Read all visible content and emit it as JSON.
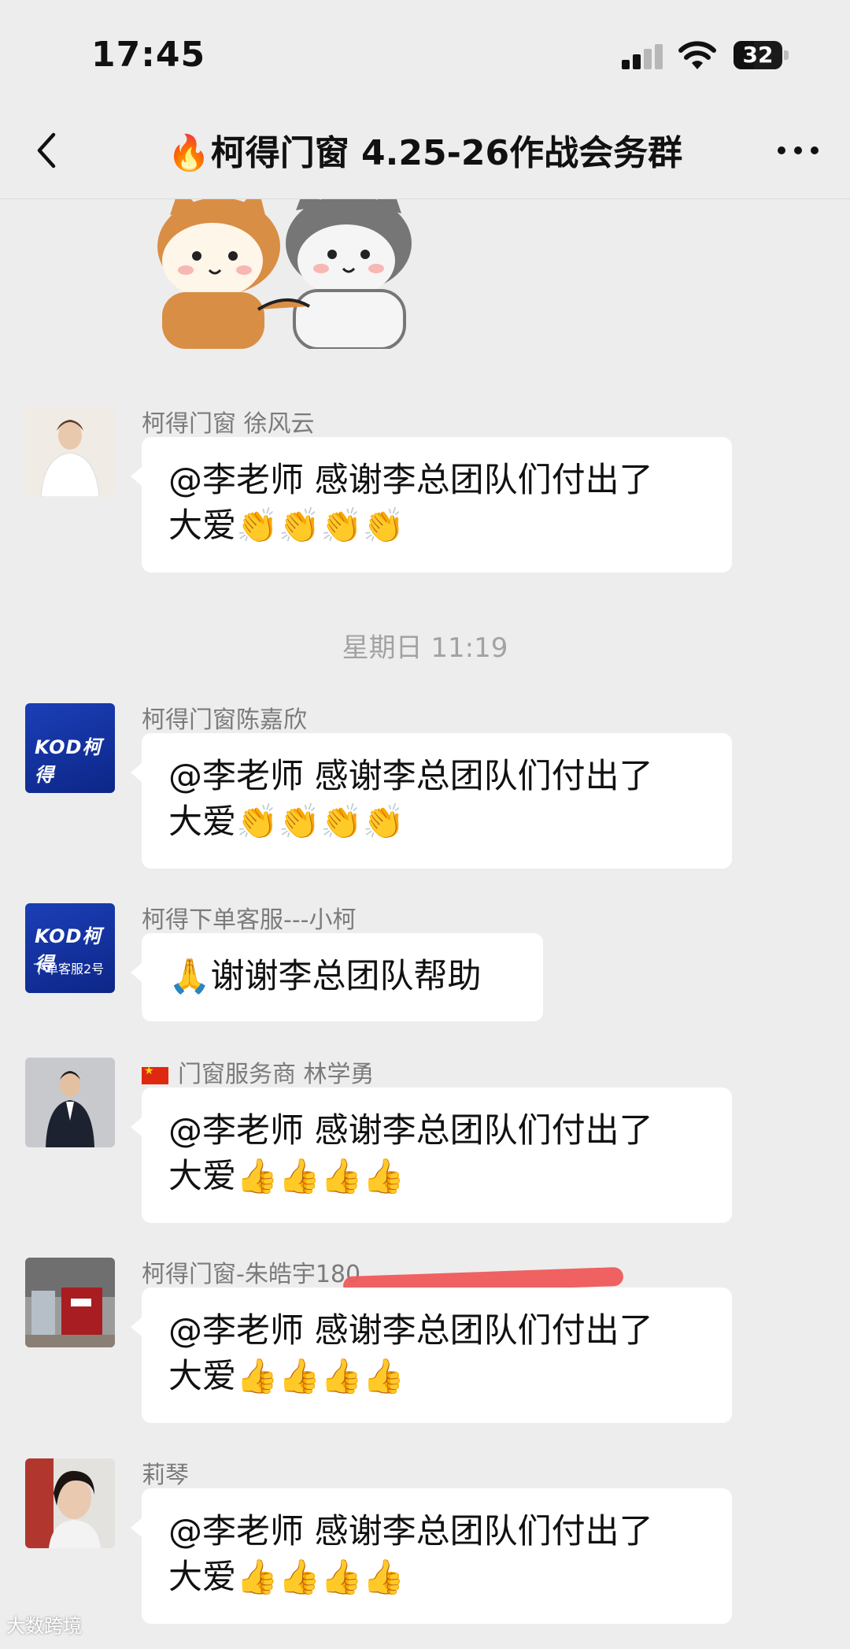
{
  "status_bar": {
    "time": "17:45",
    "battery": "32"
  },
  "nav": {
    "title": "🔥柯得门窗 4.25-26作战会务群"
  },
  "chat": {
    "messages": [
      {
        "sender": "柯得门窗  徐风云",
        "lines": [
          "@李老师 感谢李总团队们付出了",
          "大爱👏👏👏👏"
        ]
      },
      {
        "sender": "柯得门窗陈嘉欣",
        "avatar_text": "KOD柯得",
        "lines": [
          "@李老师 感谢李总团队们付出了",
          "大爱👏👏👏👏"
        ]
      },
      {
        "sender": "柯得下单客服---小柯",
        "avatar_text": "KOD柯得",
        "avatar_sub": "下单客服2号",
        "lines": [
          "🙏谢谢李总团队帮助"
        ]
      },
      {
        "sender": "门窗服务商 林学勇",
        "lines": [
          "@李老师 感谢李总团队们付出了",
          "大爱👍👍👍👍"
        ]
      },
      {
        "sender": "柯得门窗-朱皓宇180",
        "lines": [
          "@李老师 感谢李总团队们付出了",
          "大爱👍👍👍👍"
        ]
      },
      {
        "sender": "莉琴",
        "lines": [
          "@李老师 感谢李总团队们付出了",
          "大爱👍👍👍👍"
        ]
      }
    ],
    "timestamp": "星期日 11:19"
  },
  "watermark": "大数跨境"
}
